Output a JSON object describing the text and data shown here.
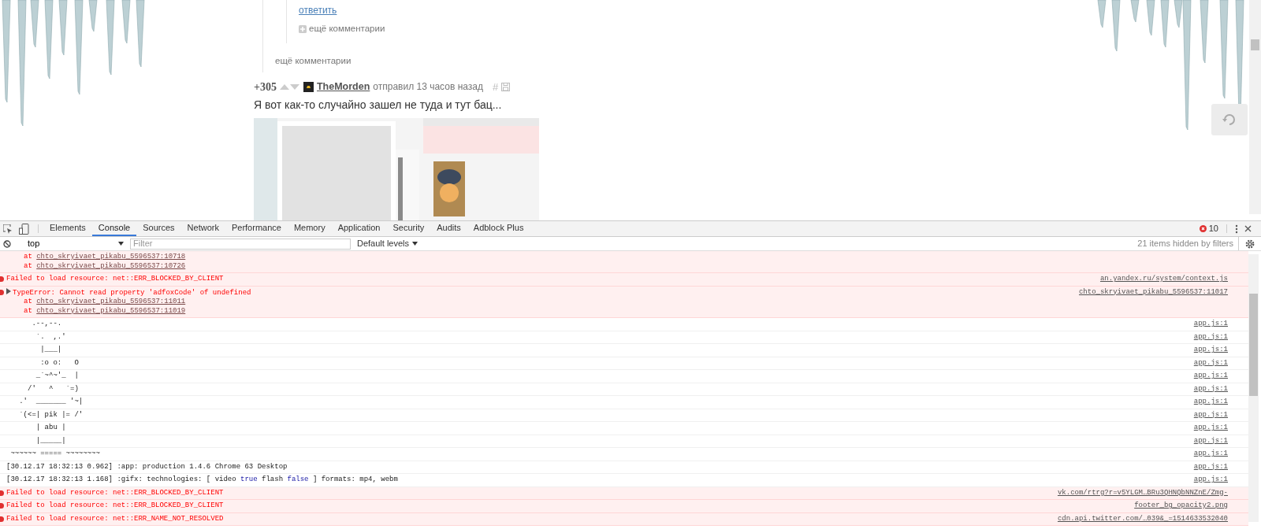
{
  "page": {
    "reply_link": "ответить",
    "more_comments_nested": "ещё комментарии",
    "more_comments": "ещё комментарии",
    "post": {
      "rating": "+305",
      "author": "TheMorden",
      "meta": "отправил 13 часов назад",
      "hash": "#",
      "title": "Я вот как-то случайно зашел не туда и тут бац..."
    }
  },
  "devtools": {
    "tabs": [
      {
        "label": "Elements",
        "selected": false
      },
      {
        "label": "Console",
        "selected": true
      },
      {
        "label": "Sources",
        "selected": false
      },
      {
        "label": "Network",
        "selected": false
      },
      {
        "label": "Performance",
        "selected": false
      },
      {
        "label": "Memory",
        "selected": false
      },
      {
        "label": "Application",
        "selected": false
      },
      {
        "label": "Security",
        "selected": false
      },
      {
        "label": "Audits",
        "selected": false
      },
      {
        "label": "Adblock Plus",
        "selected": false
      }
    ],
    "error_count": "10",
    "context": "top",
    "filter": {
      "placeholder": "Filter"
    },
    "levels": "Default levels",
    "hidden_note": "21 items hidden by filters",
    "messages": [
      {
        "kind": "error",
        "stack": [
          {
            "label": "at",
            "link": "chto_skryivaet_pikabu_5596537:10718"
          },
          {
            "label": "at",
            "link": "chto_skryivaet_pikabu_5596537:10726"
          }
        ]
      },
      {
        "kind": "error",
        "text": "Failed to load resource: net::ERR_BLOCKED_BY_CLIENT",
        "source": "an.yandex.ru/system/context.js"
      },
      {
        "kind": "error",
        "expanded": false,
        "text": "TypeError: Cannot read property 'adfoxCode' of undefined",
        "stack": [
          {
            "label": "at",
            "link": "chto_skryivaet_pikabu_5596537:11011"
          },
          {
            "label": "at",
            "link": "chto_skryivaet_pikabu_5596537:11019"
          }
        ],
        "source": "chto_skryivaet_pikabu_5596537:11017"
      },
      {
        "kind": "log",
        "text": "      .--,--.",
        "source": "app.js:1"
      },
      {
        "kind": "log",
        "text": "       `.  ,.'",
        "source": "app.js:1"
      },
      {
        "kind": "log",
        "text": "        |___|",
        "source": "app.js:1"
      },
      {
        "kind": "log",
        "text": "        :o o:   O",
        "source": "app.js:1"
      },
      {
        "kind": "log",
        "text": "       _`~^~'_  |",
        "source": "app.js:1"
      },
      {
        "kind": "log",
        "text": "     /'   ^   `=)",
        "source": "app.js:1"
      },
      {
        "kind": "log",
        "text": "   .'  _______ '~|",
        "source": "app.js:1"
      },
      {
        "kind": "log",
        "text": "   `(<=| pik |= /'",
        "source": "app.js:1"
      },
      {
        "kind": "log",
        "text": "       | abu |",
        "source": "app.js:1"
      },
      {
        "kind": "log",
        "text": "       |_____|",
        "source": "app.js:1"
      },
      {
        "kind": "log",
        "text": " ~~~~~~ ===== ~~~~~~~~",
        "source": "app.js:1"
      },
      {
        "kind": "log",
        "text": "[30.12.17 18:32:13 0.962] :app: production 1.4.6 Chrome 63 Desktop",
        "source": "app.js:1"
      },
      {
        "kind": "log",
        "segments": [
          {
            "kind": "plain",
            "text": "[30.12.17 18:32:13 1.168] :gifx: technologies: [ video "
          },
          {
            "kind": "keyword",
            "text": "true"
          },
          {
            "kind": "plain",
            "text": " flash "
          },
          {
            "kind": "keyword",
            "text": "false"
          },
          {
            "kind": "plain",
            "text": " ] formats: mp4, webm"
          }
        ],
        "source": "app.js:1"
      },
      {
        "kind": "error",
        "text": "Failed to load resource: net::ERR_BLOCKED_BY_CLIENT",
        "source": "vk.com/rtrg?r=v5YLGM…BRu3QHNQbNNZnE/Zmg-"
      },
      {
        "kind": "error",
        "text": "Failed to load resource: net::ERR_BLOCKED_BY_CLIENT",
        "source": "footer_bg_opacity2.png"
      },
      {
        "kind": "error",
        "text": "Failed to load resource: net::ERR_NAME_NOT_RESOLVED",
        "source": "cdn.api.twitter.com/…039&_=1514633532040"
      }
    ]
  }
}
